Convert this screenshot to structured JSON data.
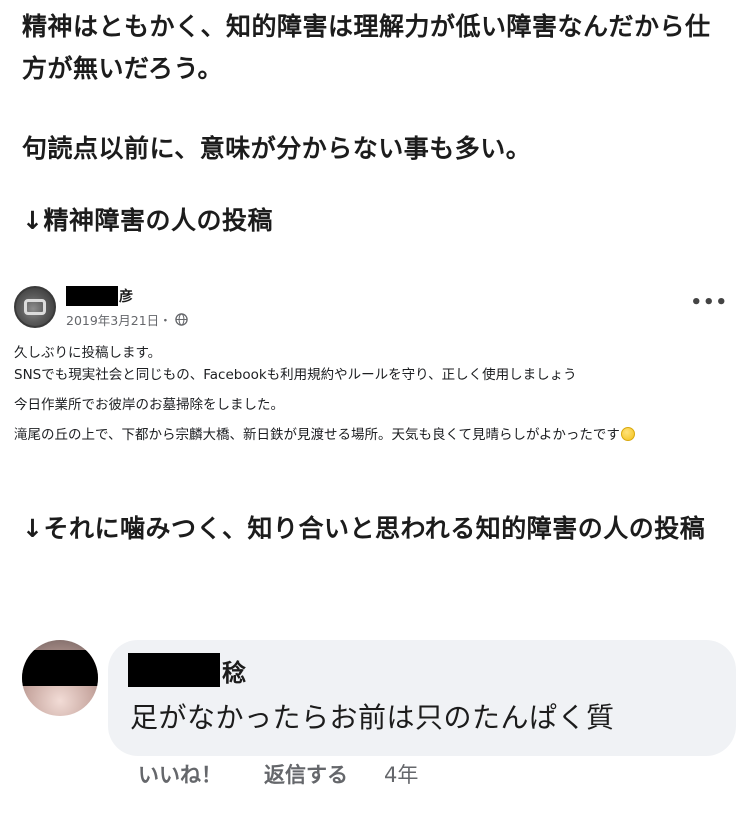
{
  "intro": {
    "paragraph1": "精神はともかく、知的障害は理解力が低い障害なんだから仕方が無いだろう。",
    "paragraph2": "句読点以前に、意味が分からない事も多い。",
    "label1": "↓精神障害の人の投稿",
    "label2": "↓それに噛みつく、知り合いと思われる知的障害の人の投稿"
  },
  "post": {
    "author_suffix": "彦",
    "date": "2019年3月21日・",
    "more_label": "•••",
    "lines": [
      "久しぶりに投稿します。",
      "SNSでも現実社会と同じもの、Facebookも利用規約やルールを守り、正しく使用しましょう",
      "今日作業所でお彼岸のお墓掃除をしました。",
      "滝尾の丘の上で、下都から宗麟大橋、新日鉄が見渡せる場所。天気も良くて見晴らしがよかったです"
    ]
  },
  "comment": {
    "author_suffix": "稔",
    "text": "足がなかったらお前は只のたんぱく質",
    "like_label": "いいね！",
    "reply_label": "返信する",
    "time": "4年"
  },
  "colors": {
    "bubble": "#f0f2f5",
    "meta_gray": "#65676b",
    "redaction": "#000000"
  },
  "icons": {
    "post_visibility": "globe-icon",
    "post_emoji": "smiley-icon",
    "post_menu": "more-options-icon"
  }
}
